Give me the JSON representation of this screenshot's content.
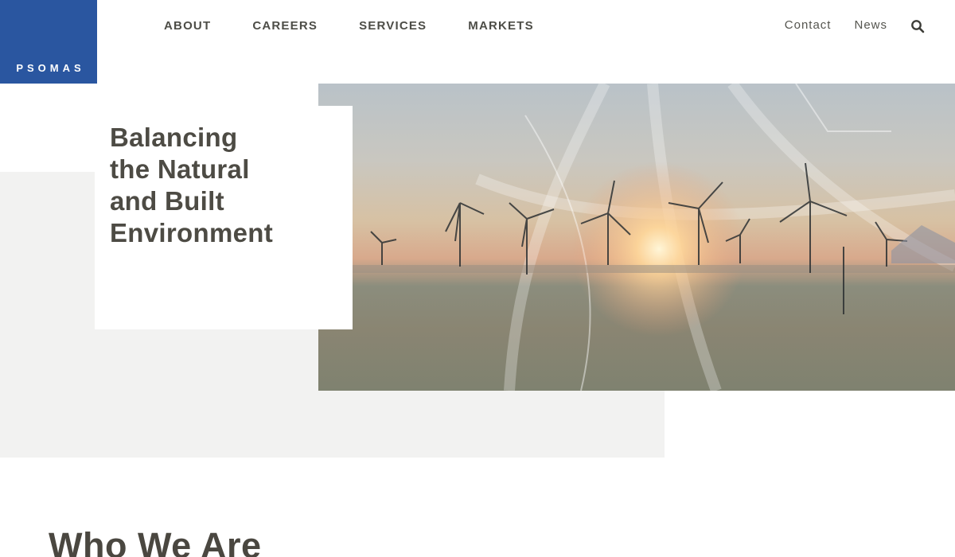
{
  "brand": {
    "logo_text": "PSOMAS",
    "color": "#2a56a0"
  },
  "nav": {
    "main": [
      {
        "label": "ABOUT"
      },
      {
        "label": "CAREERS"
      },
      {
        "label": "SERVICES"
      },
      {
        "label": "MARKETS"
      }
    ],
    "utility": {
      "contact": "Contact",
      "news": "News",
      "search_icon": "search-icon"
    }
  },
  "hero": {
    "title_lines": [
      "Balancing",
      "the Natural",
      "and Built",
      "Environment"
    ],
    "image": "wind-turbines-sunset-desert"
  },
  "section": {
    "heading": "Who We Are"
  }
}
